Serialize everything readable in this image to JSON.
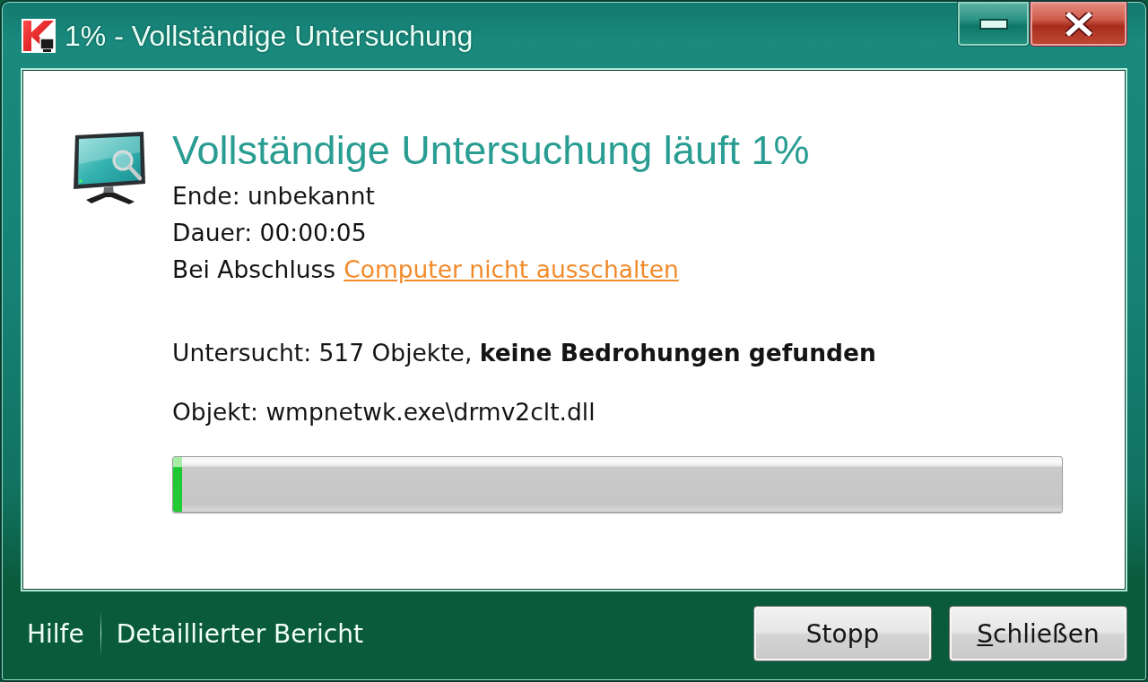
{
  "window": {
    "title": "1% - Vollständige Untersuchung"
  },
  "scan": {
    "heading": "Vollständige Untersuchung läuft 1%",
    "end": "Ende: unbekannt",
    "duration": "Dauer: 00:00:05",
    "on_completion": {
      "label": "Bei Abschluss",
      "link": "Computer nicht ausschalten"
    },
    "summary": "Untersucht: 517 Objekte, **keine Bedrohungen gefunden**",
    "current_object": "Objekt: wmpnetwk.exe\\drmv2clt.dll",
    "progress": {
      "level": 0.01
    }
  },
  "footer": {
    "links": [
      "Hilfe",
      "Detaillierter Bericht"
    ],
    "buttons": [
      {
        "label": "Stopp",
        "access_key": false
      },
      {
        "label": "Schließen",
        "access_key": true
      }
    ]
  }
}
